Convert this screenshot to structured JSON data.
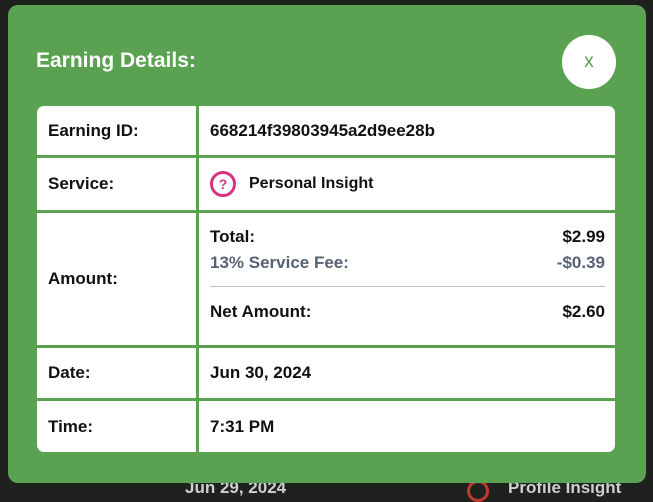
{
  "background": {
    "date_text": "Jun 29, 2024",
    "service_text": "Profile Insight"
  },
  "modal": {
    "title": "Earning Details:",
    "close_label": "x"
  },
  "details": {
    "earning_id": {
      "label": "Earning ID:",
      "value": "668214f39803945a2d9ee28b"
    },
    "service": {
      "label": "Service:",
      "icon": "question-icon",
      "value": "Personal Insight"
    },
    "amount": {
      "label": "Amount:",
      "total_label": "Total:",
      "total_value": "$2.99",
      "fee_label": "13% Service Fee:",
      "fee_value": "-$0.39",
      "net_label": "Net Amount:",
      "net_value": "$2.60"
    },
    "date": {
      "label": "Date:",
      "value": "Jun 30, 2024"
    },
    "time": {
      "label": "Time:",
      "value": "7:31 PM"
    }
  },
  "colors": {
    "modal_green": "#5aa151",
    "icon_pink": "#d63384",
    "fee_gray": "#566273",
    "backdrop": "#1f211f"
  }
}
